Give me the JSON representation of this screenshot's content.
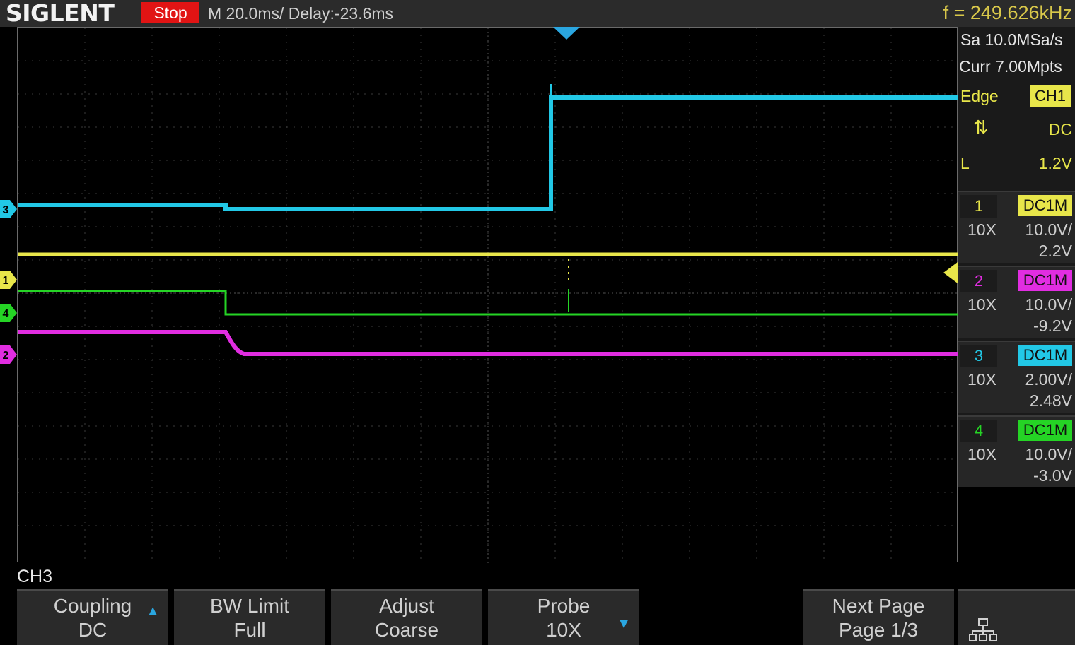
{
  "topbar": {
    "brand": "SIGLENT",
    "run_state": "Stop",
    "timebase": "M 20.0ms/ Delay:-23.6ms",
    "frequency": "f = 249.626kHz"
  },
  "acquisition": {
    "sample_rate": "Sa 10.0MSa/s",
    "memory": "Curr 7.00Mpts"
  },
  "trigger": {
    "type": "Edge",
    "source": "CH1",
    "slope_icon": "rise-fall-arrows-icon",
    "coupling": "DC",
    "level_label": "L",
    "level": "1.2V"
  },
  "channels": [
    {
      "num": "1",
      "coupling": "DC1M",
      "probe": "10X",
      "scale": "10.0V/",
      "offset": "2.2V",
      "color": "#e8e64a"
    },
    {
      "num": "2",
      "coupling": "DC1M",
      "probe": "10X",
      "scale": "10.0V/",
      "offset": "-9.2V",
      "color": "#e12de1"
    },
    {
      "num": "3",
      "coupling": "DC1M",
      "probe": "10X",
      "scale": "2.00V/",
      "offset": "2.48V",
      "color": "#22c8e6"
    },
    {
      "num": "4",
      "coupling": "DC1M",
      "probe": "10X",
      "scale": "10.0V/",
      "offset": "-3.0V",
      "color": "#25d425"
    }
  ],
  "menu": {
    "title": "CH3",
    "softkeys": [
      {
        "label": "Coupling",
        "value": "DC",
        "arrow": "up"
      },
      {
        "label": "BW Limit",
        "value": "Full",
        "arrow": ""
      },
      {
        "label": "Adjust",
        "value": "Coarse",
        "arrow": ""
      },
      {
        "label": "Probe",
        "value": "10X",
        "arrow": "down"
      },
      {
        "label": "Next Page",
        "value": "Page 1/3",
        "arrow": ""
      }
    ],
    "network_icon": "network-icon"
  },
  "colors": {
    "ch1": "#e8e64a",
    "ch2": "#e12de1",
    "ch3": "#22c8e6",
    "ch4": "#25d425",
    "trigger_marker": "#2aa6e0"
  }
}
